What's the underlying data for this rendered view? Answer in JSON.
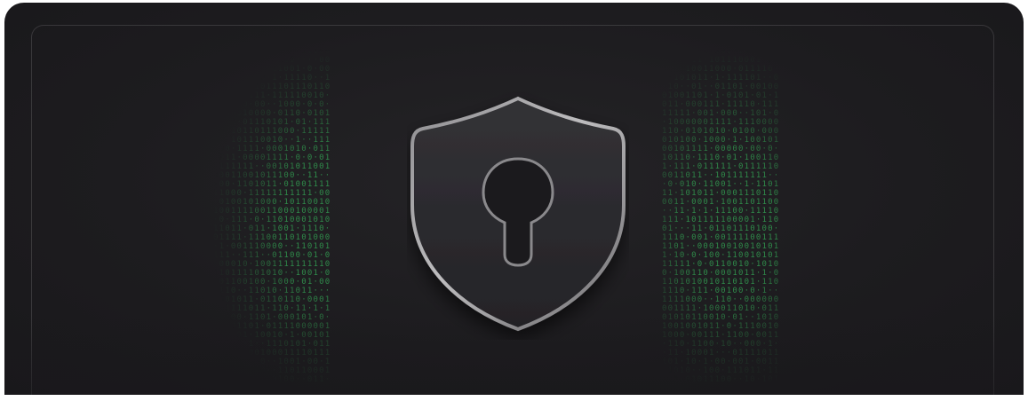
{
  "scene": {
    "icon": "shield-keyhole-icon",
    "decoration": "binary-digit-field",
    "colors": {
      "background": "#1d1c1f",
      "shield_fill": "#2c2b2f",
      "shield_edge": "#9a999c",
      "binary_green": "#2f8a4a"
    }
  }
}
